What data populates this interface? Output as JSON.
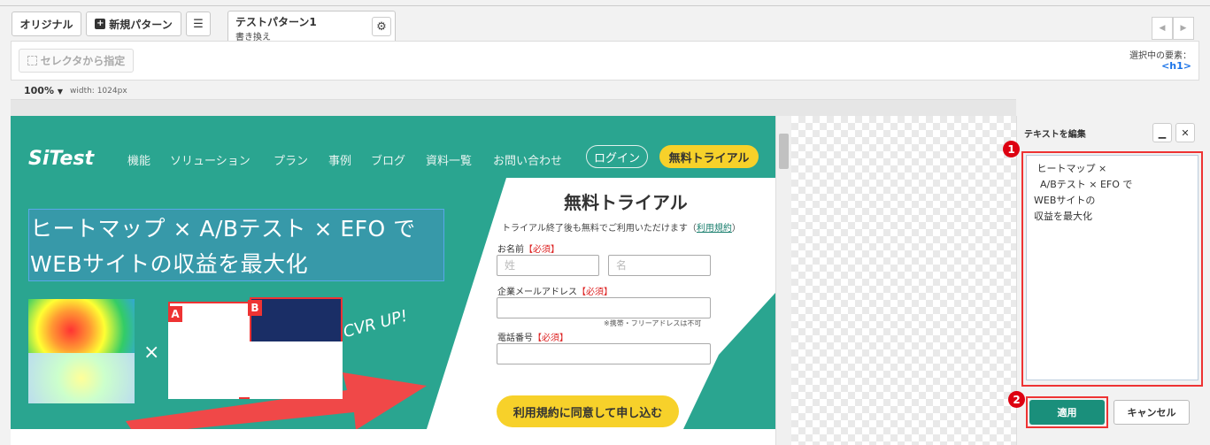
{
  "toolbar": {
    "original_label": "オリジナル",
    "new_pattern_label": "新規パターン",
    "pattern_name": "テストパターン1",
    "pattern_sub": "書き換え"
  },
  "selector": {
    "button_label": "セレクタから指定",
    "selected_label": "選択中の要素：",
    "selected_value": "<h1>"
  },
  "viewport": {
    "zoom": "100%",
    "width": "width: 1024px"
  },
  "site": {
    "logo": "SiTest",
    "nav": [
      "機能",
      "ソリューション",
      "プラン",
      "事例",
      "ブログ",
      "資料一覧",
      "お問い合わせ"
    ],
    "login": "ログイン",
    "trial": "無料トライアル",
    "hero_line1": "ヒートマップ × A/Bテスト × EFO で",
    "hero_line2": "WEBサイトの収益を最大化",
    "times": "×",
    "tag_a": "A",
    "tag_b": "B",
    "cvr": "CVR UP!",
    "form": {
      "title": "無料トライアル",
      "note_prefix": "トライアル終了後も無料でご利用いただけます（",
      "note_link": "利用規約",
      "note_suffix": "）",
      "name_label": "お名前",
      "required": "【必須】",
      "last_name_placeholder": "姓",
      "first_name_placeholder": "名",
      "email_label": "企業メールアドレス",
      "email_note": "※携帯・フリーアドレスは不可",
      "phone_label": "電話番号",
      "submit": "利用規約に同意して申し込む"
    }
  },
  "edit_panel": {
    "title": "テキストを編集",
    "text": " ヒートマップ ×\n  A/Bテスト × EFO で\nWEBサイトの\n収益を最大化",
    "badge1": "1",
    "badge2": "2",
    "apply": "適用",
    "cancel": "キャンセル"
  }
}
